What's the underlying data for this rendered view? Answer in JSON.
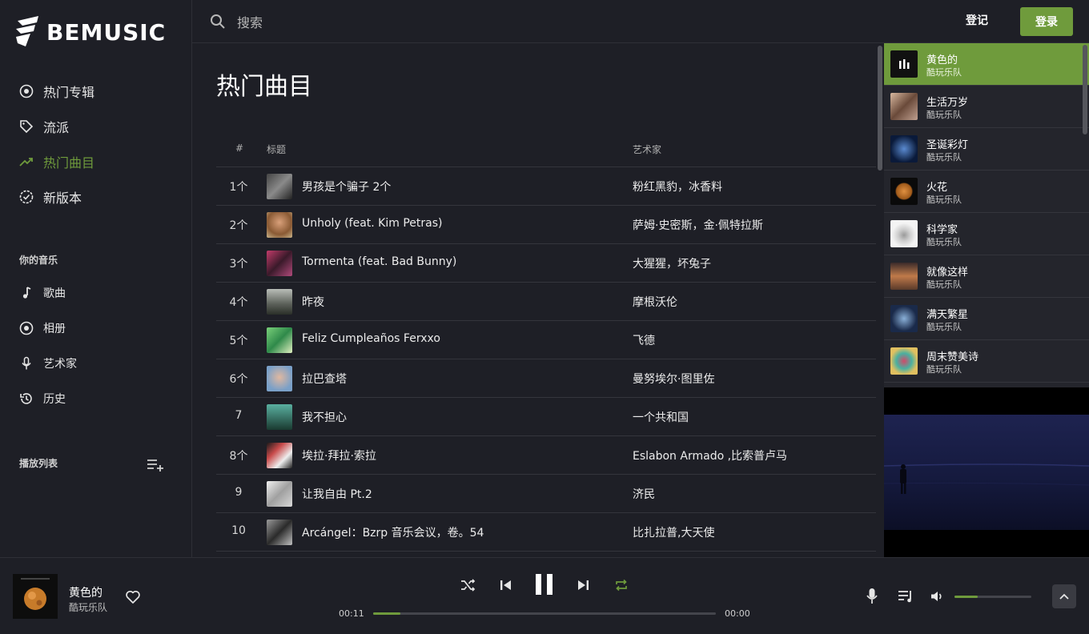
{
  "app": {
    "logo_text": "BEMUSIC"
  },
  "sidebar": {
    "nav": [
      {
        "label": "热门专辑",
        "icon": "album-icon"
      },
      {
        "label": "流派",
        "icon": "tag-icon"
      },
      {
        "label": "热门曲目",
        "icon": "trending-icon",
        "active": true
      },
      {
        "label": "新版本",
        "icon": "new-release-icon"
      }
    ],
    "your_music_title": "你的音乐",
    "your_music": [
      {
        "label": "歌曲",
        "icon": "music-note-icon"
      },
      {
        "label": "相册",
        "icon": "album-icon"
      },
      {
        "label": "艺术家",
        "icon": "microphone-icon"
      },
      {
        "label": "历史",
        "icon": "history-icon"
      }
    ],
    "playlist_title": "播放列表"
  },
  "header": {
    "search_placeholder": "搜索",
    "register_label": "登记",
    "login_label": "登录"
  },
  "main": {
    "title": "热门曲目",
    "columns": {
      "num": "#",
      "title": "标题",
      "artist": "艺术家"
    },
    "tracks": [
      {
        "num": "1个",
        "title": "男孩是个骗子 2个",
        "artist": "粉红黑豹，冰香料",
        "color": "#5a5a5a"
      },
      {
        "num": "2个",
        "title": "Unholy (feat. Kim Petras)",
        "artist": "萨姆·史密斯，金·佩特拉斯",
        "color": "#a06a44"
      },
      {
        "num": "3个",
        "title": "Tormenta (feat. Bad Bunny)",
        "artist": "大猩猩，坏兔子",
        "color": "#8a2e4a"
      },
      {
        "num": "4个",
        "title": "昨夜",
        "artist": "摩根沃伦",
        "color": "#7a7f78"
      },
      {
        "num": "5个",
        "title": "Feliz Cumpleaños Ferxxo",
        "artist": "飞德",
        "color": "#4fa85a"
      },
      {
        "num": "6个",
        "title": "拉巴查塔",
        "artist": "曼努埃尔·图里佐",
        "color": "#9fb4c8"
      },
      {
        "num": "7",
        "title": "我不担心",
        "artist": "一个共和国",
        "color": "#2f6a5a"
      },
      {
        "num": "8个",
        "title": "埃拉·拜拉·索拉",
        "artist": "Eslabon Armado ,比索普卢马",
        "color": "#3a2a2a"
      },
      {
        "num": "9",
        "title": "让我自由 Pt.2",
        "artist": "济民",
        "color": "#bdbdbd"
      },
      {
        "num": "10",
        "title": "Arcángel：Bzrp 音乐会议，卷。54",
        "artist": "比扎拉普,大天使",
        "color": "#6a6a6a"
      }
    ]
  },
  "queue": [
    {
      "name": "黄色的",
      "artist": "酷玩乐队",
      "active": true,
      "color": "#111111"
    },
    {
      "name": "生活万岁",
      "artist": "酷玩乐队",
      "color": "#b08a78"
    },
    {
      "name": "圣诞彩灯",
      "artist": "酷玩乐队",
      "color": "#1e2a4a"
    },
    {
      "name": "火花",
      "artist": "酷玩乐队",
      "color": "#c47a2a"
    },
    {
      "name": "科学家",
      "artist": "酷玩乐队",
      "color": "#e8e8e8"
    },
    {
      "name": "就像这样",
      "artist": "酷玩乐队",
      "color": "#6a4a3a"
    },
    {
      "name": "满天繁星",
      "artist": "酷玩乐队",
      "color": "#2a4a6a"
    },
    {
      "name": "周末赞美诗",
      "artist": "酷玩乐队",
      "color": "#7a9a6a"
    }
  ],
  "player": {
    "title": "黄色的",
    "artist": "酷玩乐队",
    "time_current": "00:11",
    "time_total": "00:00",
    "progress": 0.08,
    "volume": 0.3
  },
  "colors": {
    "accent": "#6f9b3c",
    "background": "#1e1f26"
  }
}
